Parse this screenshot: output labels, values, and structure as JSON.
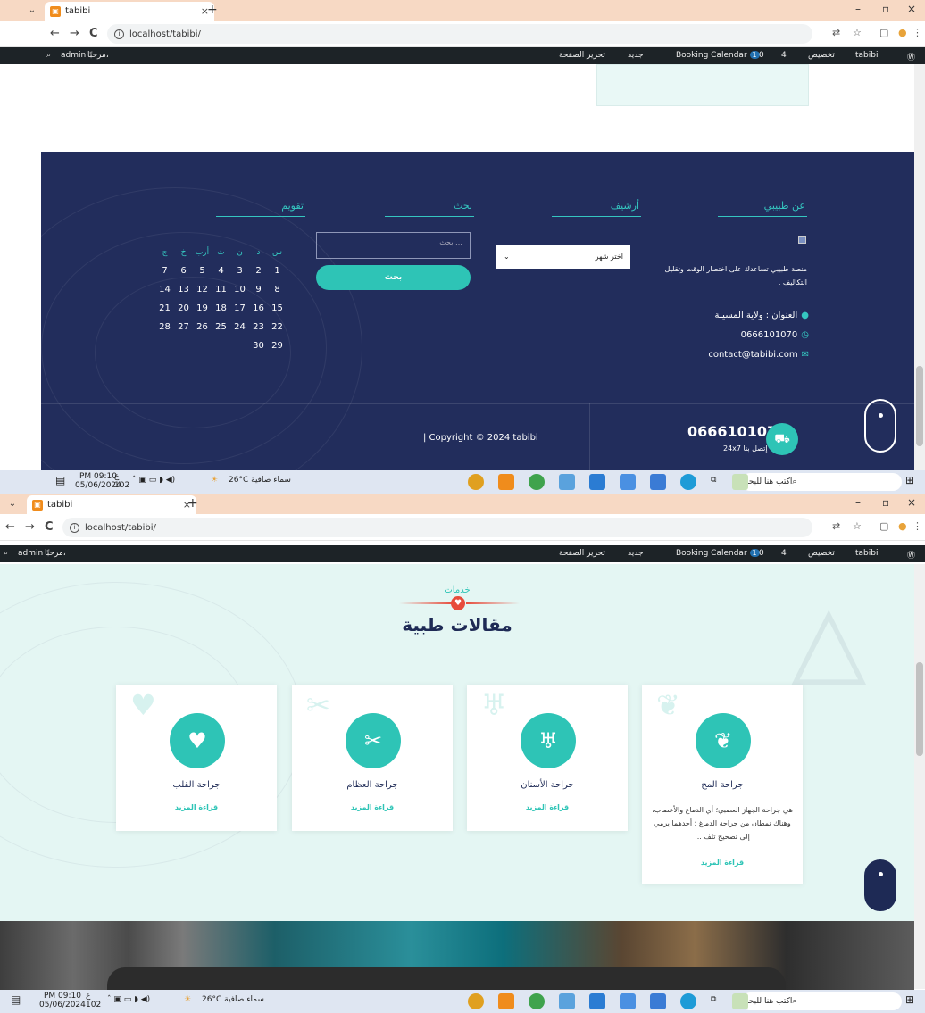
{
  "browser": {
    "tab_title": "tabibi",
    "tab_close": "×",
    "new_tab": "+",
    "url": "localhost/tabibi/",
    "nav_back": "←",
    "nav_forward": "→",
    "nav_reload": "C",
    "window_min": "–",
    "window_max": "▫",
    "window_close": "×"
  },
  "adminbar": {
    "wp_logo": "Ⓦ",
    "site": "tabibi",
    "customize": "تخصيص",
    "updates_count": "4",
    "comments_count": "0",
    "booking": "Booking Calendar",
    "booking_badge": "1",
    "new": "جديد",
    "edit_page": "تحرير الصفحة",
    "howdy": "مرحبًا،",
    "user": "admin"
  },
  "footer": {
    "about_heading": "عن طبيبي",
    "about_desc": "منصة طبيبي تساعدك على اختصار الوقت وتقليل التكاليف .",
    "address": "العنوان : ولاية المسيلة",
    "phone": "0666101070",
    "email": "contact@tabibi.com",
    "archive_heading": "أرشيف",
    "archive_select": "اختر شهر",
    "search_heading": "بحث",
    "search_placeholder": "بحث …",
    "search_button": "بحث",
    "calendar_heading": "تقويم",
    "calendar_days": [
      "س",
      "د",
      "ن",
      "ث",
      "أرب",
      "خ",
      "ج"
    ],
    "calendar_rows": [
      [
        "1",
        "2",
        "3",
        "4",
        "5",
        "6",
        "7"
      ],
      [
        "8",
        "9",
        "10",
        "11",
        "12",
        "13",
        "14"
      ],
      [
        "15",
        "16",
        "17",
        "18",
        "19",
        "20",
        "21"
      ],
      [
        "22",
        "23",
        "24",
        "25",
        "26",
        "27",
        "28"
      ],
      [
        "29",
        "30",
        "",
        "",
        "",
        "",
        ""
      ]
    ],
    "copyright": "| Copyright © 2024 tabibi",
    "call_phone": "0666101070",
    "call_label": "24x7 إتصل بنا"
  },
  "services": {
    "label": "خدمات",
    "title": "مقالات طبية",
    "read_more": "قراءة المزيد",
    "cards": [
      {
        "title": "جراحة القلب",
        "icon": "heart-pulse-icon",
        "glyph": "♥",
        "desc": ""
      },
      {
        "title": "جراحة العظام",
        "icon": "scissors-icon",
        "glyph": "✂",
        "desc": ""
      },
      {
        "title": "جراحة الأسنان",
        "icon": "tooth-icon",
        "glyph": "♅",
        "desc": ""
      },
      {
        "title": "جراحة المخ",
        "icon": "brain-icon",
        "glyph": "❦",
        "desc": "هي جراحة الجهاز العصبي؛ أي الدماغ والأعصاب، وهناك نمطان من جراحة الدماغ ؛ أحدهما يرمي إلى تصحيح تلف ..."
      }
    ]
  },
  "taskbar": {
    "search": "اكتب هنا للبحث",
    "weather": "سماء صافية",
    "temp": "26°C",
    "time": "PM 09:10",
    "date": "05/06/2024",
    "notif_count": "102",
    "lang": "ع"
  },
  "colors": {
    "accent": "#2ec4b6",
    "footer_bg": "#222d5c",
    "section_bg": "#e4f6f3",
    "admin_bg": "#1d2327",
    "heart": "#e74c3c"
  }
}
